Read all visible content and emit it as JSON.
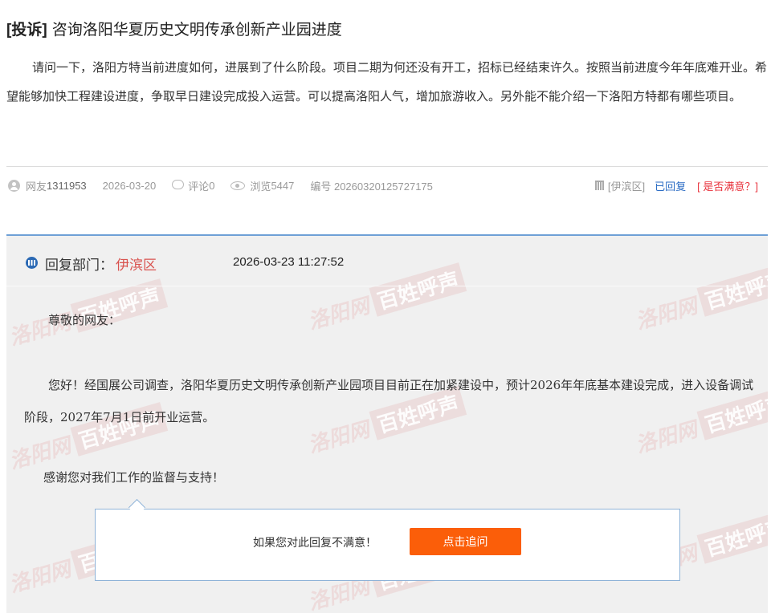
{
  "post": {
    "tag": "[投诉]",
    "title": "咨询洛阳华夏历史文明传承创新产业园进度",
    "body": "请问一下，洛阳方特当前进度如何，进展到了什么阶段。项目二期为何还没有开工，招标已经结束许久。按照当前进度今年年底难开业。希望能够加快工程建设进度，争取早日建设完成投入运营。可以提高洛阳人气，增加旅游收入。另外能不能介绍一下洛阳方特都有哪些项目。",
    "meta": {
      "user_prefix": "网友",
      "user_id": "1311953",
      "date": "2026-03-20",
      "comments_prefix": "评论",
      "comments": "0",
      "views_prefix": "浏览",
      "views": "5447",
      "id_label": "编号 20260320125727175",
      "district": "[伊滨区]",
      "replied": "已回复",
      "satisfied": "[ 是否满意？]"
    }
  },
  "reply": {
    "dept_label": "回复部门：",
    "dept_name": "伊滨区",
    "datetime": "2026-03-23 11:27:52",
    "greeting": "尊敬的网友：",
    "paragraph": "您好！经国展公司调查，洛阳华夏历史文明传承创新产业园项目目前正在加紧建设中，预计2026年年底基本建设完成，进入设备调试阶段，2027年7月1日前开业运营。",
    "thanks": "感谢您对我们工作的监督与支持！"
  },
  "followup": {
    "prompt": "如果您对此回复不满意！",
    "button": "点击追问"
  },
  "watermark": {
    "text": "洛阳网",
    "boxed": "百姓呼声"
  },
  "colors": {
    "accent_blue": "#2b6cc4",
    "alert_red": "#e8323c",
    "button_orange": "#fb5e09",
    "reply_border": "#6ea0d6"
  },
  "icons": [
    "user-icon",
    "comment-icon",
    "eye-icon",
    "department-icon",
    "department-badge-icon"
  ]
}
